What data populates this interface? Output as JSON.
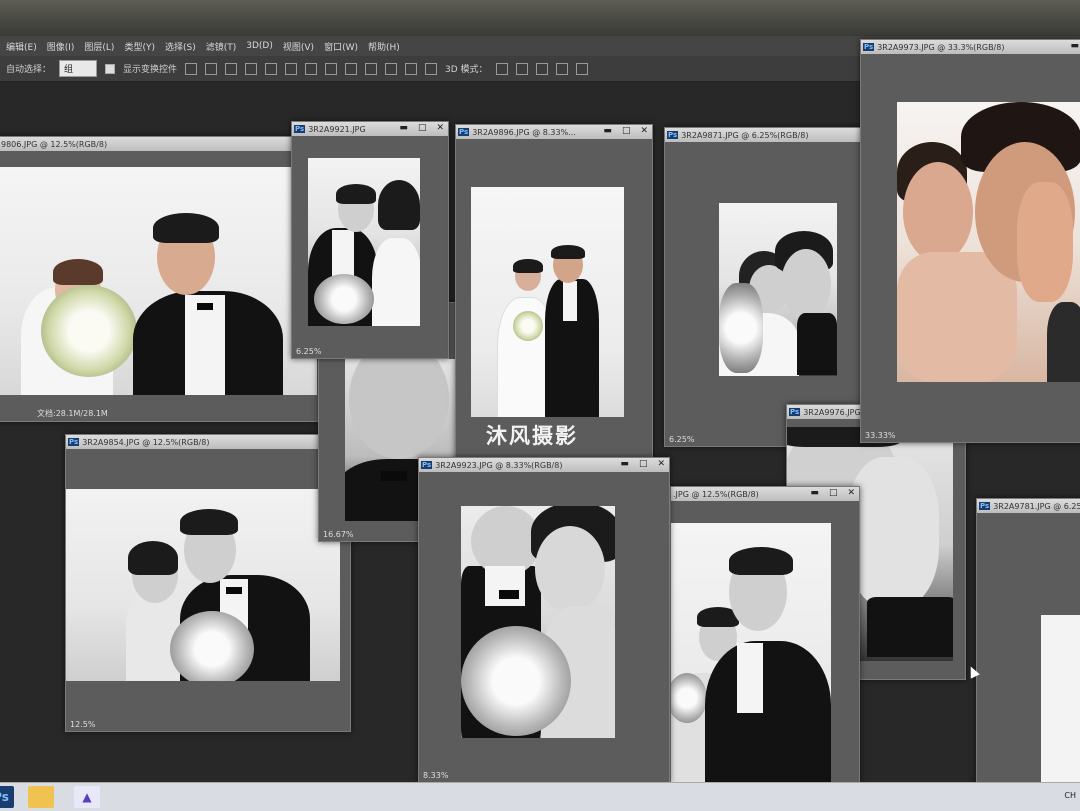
{
  "menu": [
    "编辑(E)",
    "图像(I)",
    "图层(L)",
    "类型(Y)",
    "选择(S)",
    "滤镜(T)",
    "3D(D)",
    "视图(V)",
    "窗口(W)",
    "帮助(H)"
  ],
  "options": {
    "auto_select": "自动选择：",
    "group": "组",
    "show_transform": "显示变换控件",
    "mode3d": "3D 模式："
  },
  "windows": {
    "w9806": {
      "title": "9806.JPG @ 12.5%(RGB/8)",
      "status": "文档:28.1M/28.1M"
    },
    "w9921": {
      "title": "3R2A9921.JPG",
      "status": "6.25%"
    },
    "w9896": {
      "title": "3R2A9896.JPG @ 8.33%...",
      "status": ""
    },
    "w9871": {
      "title": "3R2A9871.JPG @ 6.25%(RGB/8)",
      "status": "6.25%"
    },
    "w9973": {
      "title": "3R2A9973.JPG @ 33.3%(RGB/8)",
      "status": "33.33%"
    },
    "w9854": {
      "title": "3R2A9854.JPG @ 12.5%(RGB/8)",
      "status": "12.5%"
    },
    "wmid": {
      "title": "",
      "status": "16.67%"
    },
    "w9923": {
      "title": "3R2A9923.JPG @ 8.33%(RGB/8)",
      "status": "8.33%"
    },
    "w9976": {
      "title": "3R2A9976.JPG",
      "status": ""
    },
    "w12": {
      "title": ".JPG @ 12.5%(RGB/8)",
      "status": ""
    },
    "w9781": {
      "title": "3R2A9781.JPG @ 6.25%",
      "status": ""
    }
  },
  "brand": "沐风摄影",
  "tray": "CH"
}
